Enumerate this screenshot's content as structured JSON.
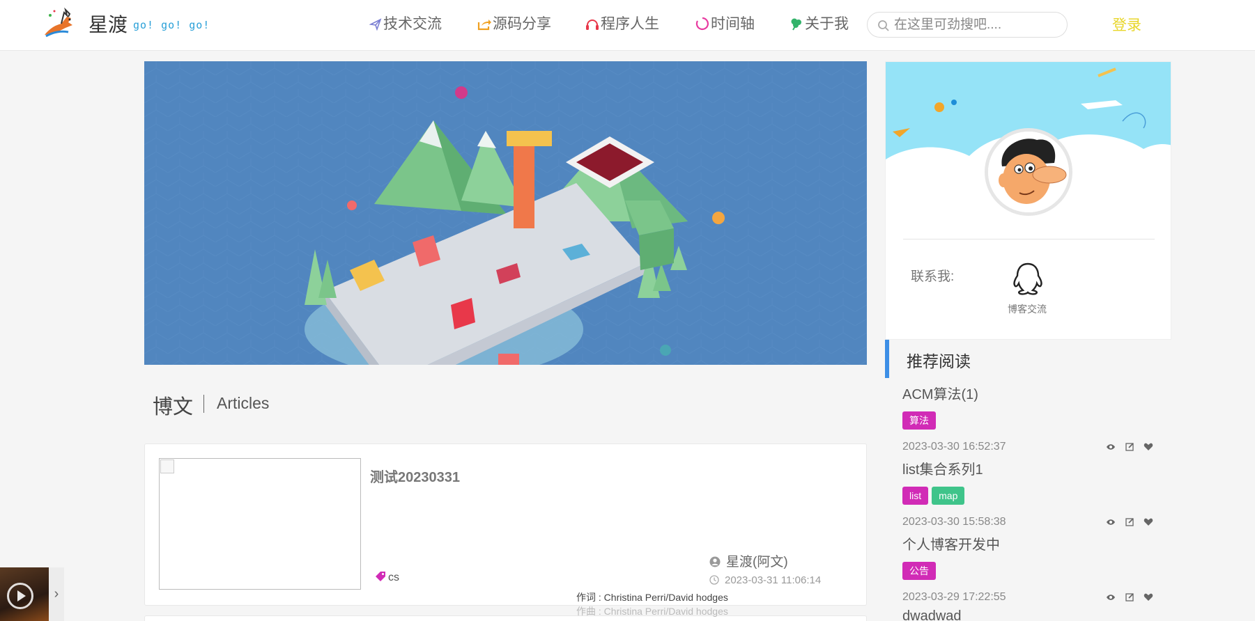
{
  "header": {
    "brand": "星渡",
    "slogan": "go! go! go!",
    "nav": [
      {
        "label": "技术交流",
        "icon": "paper-plane-icon",
        "color": "#7b7fd4"
      },
      {
        "label": "源码分享",
        "icon": "share-icon",
        "color": "#f0a020"
      },
      {
        "label": "程序人生",
        "icon": "headphones-icon",
        "color": "#e8384a"
      },
      {
        "label": "时间轴",
        "icon": "spinner-icon",
        "color": "#e83aa0"
      },
      {
        "label": "关于我",
        "icon": "leaf-icon",
        "color": "#33b36a"
      }
    ],
    "search_placeholder": "在这里可劲搜吧....",
    "search_value": "",
    "login_label": "登录"
  },
  "articles": {
    "title": "博文",
    "subtitle": "Articles"
  },
  "article_card": {
    "title": "测试20230331",
    "tag": "cs",
    "author": "星渡(阿文)",
    "date": "2023-03-31 11:06:14"
  },
  "lyrics": {
    "line1": "作词 : Christina Perri/David hodges",
    "line2": "作曲 : Christina Perri/David hodges"
  },
  "sidebar": {
    "contact_label": "联系我:",
    "qq_label": "博客交流",
    "recommend_title": "推荐阅读",
    "items": [
      {
        "title": "ACM算法(1)",
        "tags": [
          {
            "label": "算法",
            "color": "#d12bb6"
          }
        ],
        "date": "2023-03-30 16:52:37"
      },
      {
        "title": "list集合系列1",
        "tags": [
          {
            "label": "list",
            "color": "#d12bb6"
          },
          {
            "label": "map",
            "color": "#3fc48a"
          }
        ],
        "date": "2023-03-30 15:58:38"
      },
      {
        "title": "个人博客开发中",
        "tags": [
          {
            "label": "公告",
            "color": "#d12bb6"
          }
        ],
        "date": "2023-03-29 17:22:55"
      },
      {
        "title": "dwadwad",
        "tags": [],
        "date": ""
      }
    ]
  },
  "colors": {
    "accent_blue": "#3d8fe6",
    "login_yellow": "#e8d62a",
    "banner_blue": "#5186bf"
  }
}
